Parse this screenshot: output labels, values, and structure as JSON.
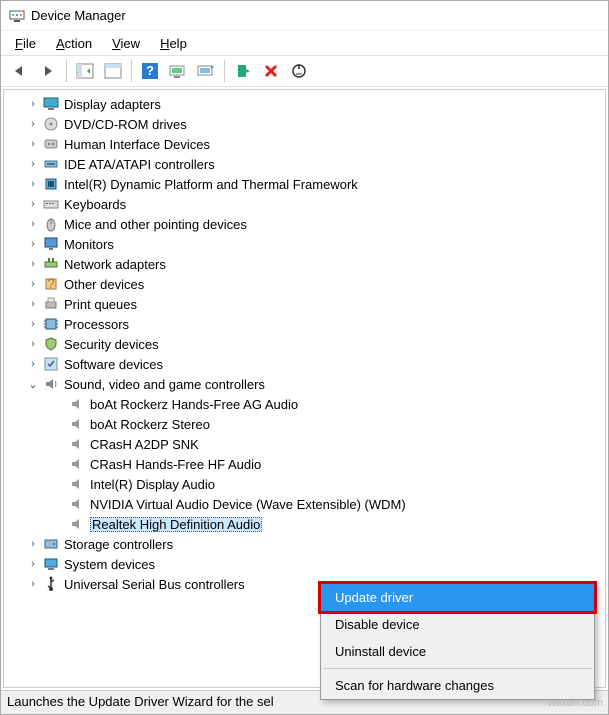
{
  "window": {
    "title": "Device Manager"
  },
  "menubar": [
    "File",
    "Action",
    "View",
    "Help"
  ],
  "tree": {
    "categories": [
      {
        "label": "Display adapters",
        "icon": "display",
        "expanded": false
      },
      {
        "label": "DVD/CD-ROM drives",
        "icon": "disc",
        "expanded": false
      },
      {
        "label": "Human Interface Devices",
        "icon": "hid",
        "expanded": false
      },
      {
        "label": "IDE ATA/ATAPI controllers",
        "icon": "ide",
        "expanded": false
      },
      {
        "label": "Intel(R) Dynamic Platform and Thermal Framework",
        "icon": "chip",
        "expanded": false
      },
      {
        "label": "Keyboards",
        "icon": "keyboard",
        "expanded": false
      },
      {
        "label": "Mice and other pointing devices",
        "icon": "mouse",
        "expanded": false
      },
      {
        "label": "Monitors",
        "icon": "monitor",
        "expanded": false
      },
      {
        "label": "Network adapters",
        "icon": "net",
        "expanded": false
      },
      {
        "label": "Other devices",
        "icon": "other",
        "expanded": false
      },
      {
        "label": "Print queues",
        "icon": "printer",
        "expanded": false
      },
      {
        "label": "Processors",
        "icon": "cpu",
        "expanded": false
      },
      {
        "label": "Security devices",
        "icon": "security",
        "expanded": false
      },
      {
        "label": "Software devices",
        "icon": "software",
        "expanded": false
      },
      {
        "label": "Sound, video and game controllers",
        "icon": "sound",
        "expanded": true,
        "children": [
          {
            "label": "boAt Rockerz Hands-Free AG Audio"
          },
          {
            "label": "boAt Rockerz Stereo"
          },
          {
            "label": "CRasH A2DP SNK"
          },
          {
            "label": "CRasH Hands-Free HF Audio"
          },
          {
            "label": "Intel(R) Display Audio"
          },
          {
            "label": "NVIDIA Virtual Audio Device (Wave Extensible) (WDM)"
          },
          {
            "label": "Realtek High Definition Audio",
            "selected": true
          }
        ]
      },
      {
        "label": "Storage controllers",
        "icon": "storage",
        "expanded": false
      },
      {
        "label": "System devices",
        "icon": "system",
        "expanded": false
      },
      {
        "label": "Universal Serial Bus controllers",
        "icon": "usb",
        "expanded": false
      }
    ]
  },
  "context_menu": {
    "items": [
      {
        "label": "Update driver",
        "highlighted": true
      },
      {
        "label": "Disable device"
      },
      {
        "label": "Uninstall device"
      },
      {
        "label": "Scan for hardware changes"
      }
    ]
  },
  "statusbar": {
    "text": "Launches the Update Driver Wizard for the sel"
  },
  "watermark": "wsxdn.com"
}
